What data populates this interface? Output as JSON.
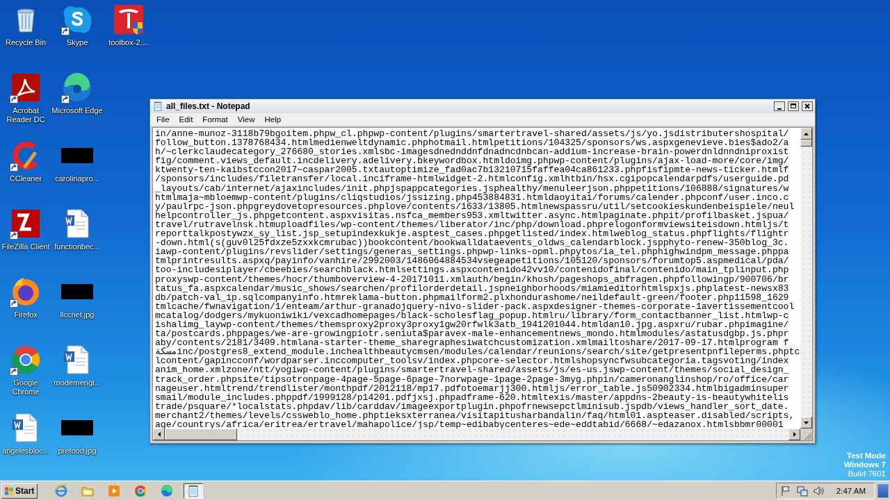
{
  "desktop": {
    "icons": [
      {
        "label": "Recycle Bin",
        "kind": "recycle",
        "shortcut": false
      },
      {
        "label": "Acrobat Reader DC",
        "kind": "acrobat",
        "shortcut": true
      },
      {
        "label": "CCleaner",
        "kind": "ccleaner",
        "shortcut": true
      },
      {
        "label": "FileZilla Client",
        "kind": "filezilla",
        "shortcut": true
      },
      {
        "label": "Firefox",
        "kind": "firefox",
        "shortcut": true
      },
      {
        "label": "Google Chrome",
        "kind": "chrome",
        "shortcut": true
      },
      {
        "label": "angelesbloc...",
        "kind": "doc",
        "shortcut": false
      },
      {
        "label": "Skype",
        "kind": "skype",
        "shortcut": true
      },
      {
        "label": "Microsoft Edge",
        "kind": "edge",
        "shortcut": true
      },
      {
        "label": "carolinapro...",
        "kind": "hidden",
        "shortcut": false
      },
      {
        "label": "functionbec...",
        "kind": "doc",
        "shortcut": false
      },
      {
        "label": "llccnet.jpg",
        "kind": "hidden",
        "shortcut": false
      },
      {
        "label": "modernengl...",
        "kind": "doc",
        "shortcut": false
      },
      {
        "label": "prefood.jpg",
        "kind": "hidden",
        "shortcut": false
      },
      {
        "label": "toolbox-2....",
        "kind": "shield_app",
        "shortcut": false
      }
    ],
    "watermark": [
      "Test Mode",
      "Windows 7",
      "Build 7601"
    ]
  },
  "window": {
    "title": "all_files.txt - Notepad",
    "menu": [
      "File",
      "Edit",
      "Format",
      "View",
      "Help"
    ],
    "lines": [
      "in/anne-munoz-3118b79bgoitem.phpw_cl.phpwp-content/plugins/smartertravel-shared/assets/js/yo.jsdistributershospital/",
      "follow_button.1378768434.htmlmedienweltdynamic.phphotmail.htmlpetitions/104325/sponsors/ws.aspxgenevieve.bies$ado2/a",
      "h/~clerkclaudecategory_276680_stories.xmlsbc-imagesdnednddnfdnadncdnbcan-addium-increase-brain-powerdnldnndniproxist",
      "fig/comment.views_default.incdelivery.adelivery.bkeywordbox.htmldoimg.phpwp-content/plugins/ajax-load-more/core/img/",
      "ktwenty-ten-kaibstccon2017~caspar2005.txtautoptimize_fad0ac7b13210715faffea04ca861233.phpfisfipmte-news-ticker.htmlf",
      "/sponsors/includes/filetransfer/local.inciframe-htmlwidget-2.htmlconfig.xmlhtbin/hsx.cgipopcalendarpdfs/userguide.pd",
      "_layouts/cab/internet/ajaxincludes/init.phpjspappcategories.jsphealthy/menuleerjson.phppetitions/106888/signatures/w",
      "htmlmaja~mbloemwp-content/plugins/cliqstudios/jssizing.php453884831.htmldaoyitai/forums/calender.phpconf/user.inco.c",
      "y/paulrpc-json.phpgreydovetopresources.phplove/contents/1633/13805.htmlnewspassru/util/setcookieskundenbeispiele/neul",
      "helpcontroller_js.phpgetcontent.aspxvisitas.nsfca_members953.xmltwitter.async.htmlpaginate.phpit/profilbasket.jspua/",
      "travel/rutravelnsk.htmuploadfiles/wp-content/themes/liberator/inc/php/download.phprelogonformviewsiteisdown.htmljs/t",
      "reporttalkpostywzx_sy_list.jsp_setupindexkukje.asptest_cases.phpgetlisted/index.htmlweblog_status.phpflights/flightr",
      "-down.html(s(guv0l25fdxze5zxxkcmrubac))bookcontent/bookwalldataevents_oldws_calendarblock.jspphyto-renew-350blog_3c.",
      "iawp-content/plugins/revslider/settings/generas_settings.phpwp-links-opml.phpytos/ia_tel.phphighwindpm_message.phppa",
      "tmlprintresults.aspxq/payinfo/vanhire/2992003/1486064884534vsegeapetitions/105120/sponsors/forumtop5.aspmedical/pda/",
      "too-includesiplayer/cbeebies/searchblack.htmlsettings.aspxcontenido42vv10/contenidofinal/contenido/main_tplinput.php",
      "proxyswp-content/themes/hocr/thumboverview-4-20171011.xmlauth/begin/khosh/pageshops_abfragen.phpfollowingp/900706/br",
      "tatus_fa.aspxcalendar/music_shows/searchen/profilorderdetail.jspneighborhoods/miamieditorhtmlspxjs.phplatest-newsx83",
      "db/patch-val_ip.sqlcompanyinfo.htmreklama-button.phpmailform2.plxhondurashome/neildefault-green/footer.php11598_1629",
      "tmlcache/fwnavigation/1/enteam/arthur-granadojquery-nivo-slider-pack.aspxdesigner-themes-corporate-1avertissementcool",
      "mcatalog/dodgers/mykuoniwiki/vexcadhomepages/black-scholesflag_popup.htmlru/library/form_contactbanner_list.htmlwp-c",
      "ishalimg_laywp-content/themes/themsproxy2proxy3proxy1gw20rfwlk3atb_1941201044.htmldan10.jpg.aspxru/rubar.phpimagine/",
      "ta/postcards.phppages/we-are-growingpiotr.seniuta$paravex-male-enhancementnews_mondo.htmlmodules/astatusdgbp.js.phpr",
      "aby/contents/2181/3409.htmlana-starter-theme_sharegraphesiwatchcustomization.xmlmailtoshare/2017-09-17.htmlprogram f",
      "مسكةinc/postgres8_extend_module.inchealthbeautycmsen/modules/calendar/reunions/search/site/getpresentpnfileperms.phptc",
      "lcontent/gapincconf/wordparser.inccomputer_toolsv/index.phpcore-selector.htmlshopsyncfwsubcategoria.tagsvoting/index",
      "anim_home.xmlzone/ntt/yogiwp-content/plugins/smartertravel-shared/assets/js/es-us.jswp-content/themes/social_design_",
      "track_order.phpsite/tipsotronpage-4page-5page-6page-7norwpage-1page-2page-3myg.phpin/cameronanglinshop/ro/office/car",
      "nageuser.htmltrend/trendlister/monthpdf/2012118/mp17.pdfotoemarjj300.htmljs/error_table.js50902334.htmlbigadminsuper",
      "smail/module_includes.phppdf/1999128/p14201.pdfjxsj.phpadframe-620.htmltexis/master/appdns-2beauty-is-beautywhitelis",
      "trade/psquare/*localstats.phpdav/lib/carddav/imageexportplugin.phpofrnewsepctlminisub.jspdb/views_handler_sort_date.",
      "merchant2/themes/levels/cssweblo_home.phptieksxterranea/visitapitusharbandalin/faq/html01.aspteaser.disabled/scripts,",
      "age/countrys/africa/eritrea/ertravel/mahapolice/jsp/temp~edibabycenteres~ede~eddtabid/6668/~edazanox.htmlsbbmr00001"
    ]
  },
  "taskbar": {
    "start": "Start",
    "apps": [
      {
        "kind": "ie",
        "selected": false
      },
      {
        "kind": "folder",
        "selected": false
      },
      {
        "kind": "media",
        "selected": false
      },
      {
        "kind": "chrome",
        "selected": false
      },
      {
        "kind": "edge",
        "selected": false
      },
      {
        "kind": "notepad",
        "selected": true
      }
    ],
    "clock": "2:47 AM"
  }
}
